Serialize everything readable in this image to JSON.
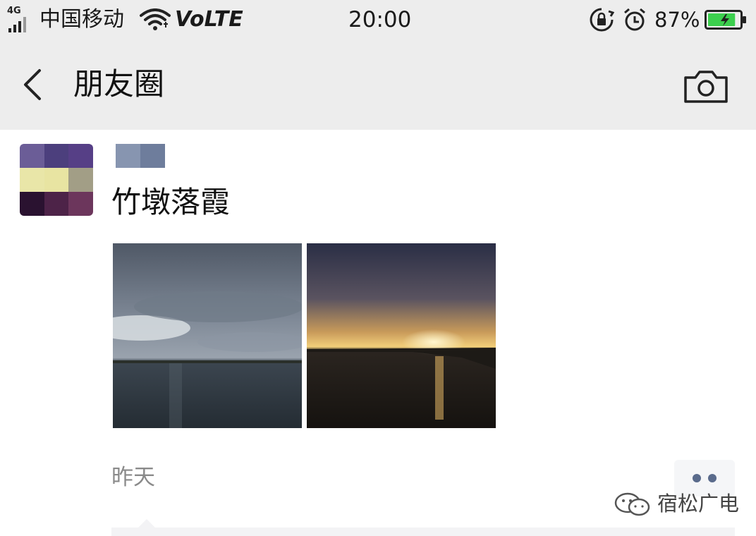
{
  "status_bar": {
    "network_type": "4G",
    "carrier": "中国移动",
    "volte": "VoLTE",
    "time": "20:00",
    "battery_percent": "87%",
    "battery_level": 0.87,
    "icons": [
      "signal-icon",
      "wifi-icon",
      "rotation-lock-icon",
      "alarm-icon",
      "battery-charging-icon"
    ]
  },
  "title_bar": {
    "title": "朋友圈",
    "back_icon": "chevron-left-icon",
    "camera_icon": "camera-icon"
  },
  "post": {
    "avatar": "pixelated-avatar",
    "nickname": "pixelated-nickname",
    "text": "竹墩落霞",
    "photos": [
      "cloudy-lake-photo",
      "sunset-lake-photo"
    ],
    "time": "昨天",
    "more_icon": "more-dots-icon"
  },
  "watermark": {
    "icon": "wechat-icon",
    "text": "宿松广电"
  },
  "colors": {
    "bar_background": "#ededed",
    "page_background": "#ffffff",
    "time_text": "#8a8a8a",
    "more_dots": "#5a6b8c",
    "battery_green": "#3ccf4e"
  }
}
